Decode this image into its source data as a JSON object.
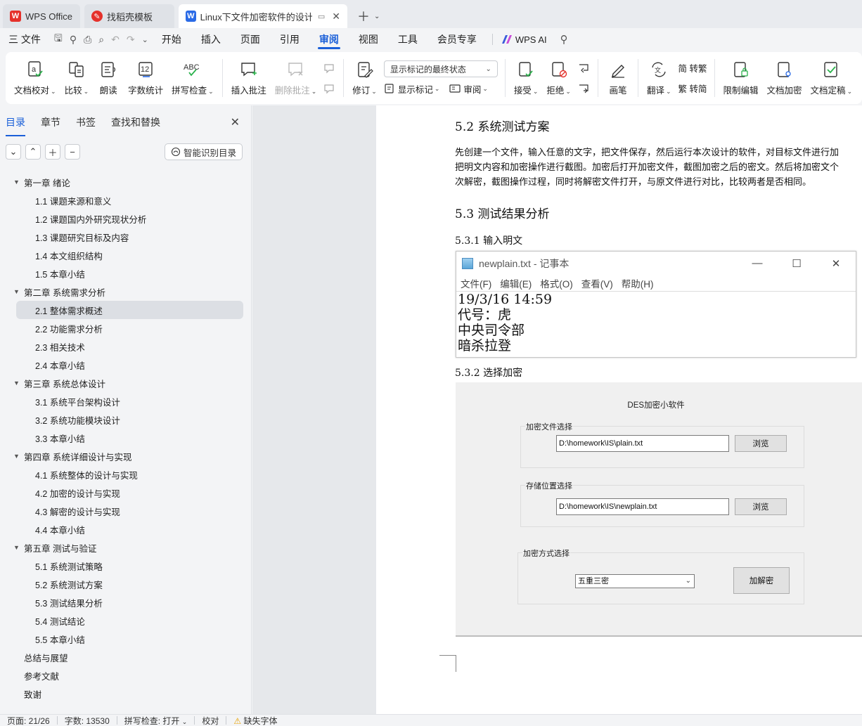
{
  "tabs": [
    {
      "label": "WPS Office"
    },
    {
      "label": "找稻壳模板"
    },
    {
      "label": "Linux下文件加密软件的设计与"
    }
  ],
  "menubar": {
    "file": "三 文件",
    "items": [
      "开始",
      "插入",
      "页面",
      "引用",
      "审阅",
      "视图",
      "工具",
      "会员专享"
    ],
    "active": "审阅",
    "wps_ai": "WPS AI"
  },
  "ribbon": {
    "doc_check": "文档校对",
    "compare": "比较",
    "read_aloud": "朗读",
    "word_count": "字数统计",
    "spell_check": "拼写检查",
    "insert_comment": "插入批注",
    "delete_comment": "删除批注",
    "revise": "修订",
    "display_mode": "显示标记的最终状态",
    "show_marks": "显示标记",
    "review": "审阅",
    "accept": "接受",
    "reject": "拒绝",
    "pen": "画笔",
    "translate": "翻译",
    "to_trad": "简 转繁",
    "to_simp": "繁 转简",
    "restrict_edit": "限制编辑",
    "doc_encrypt": "文档加密",
    "doc_finalize": "文档定稿"
  },
  "panel": {
    "tabs": [
      "目录",
      "章节",
      "书签",
      "查找和替换"
    ],
    "active_tab": "目录",
    "smart_button": "智能识别目录",
    "toc": [
      {
        "text": "第一章  绪论",
        "level": 1,
        "expanded": true
      },
      {
        "text": "1.1  课题来源和意义",
        "level": 2
      },
      {
        "text": "1.2  课题国内外研究现状分析",
        "level": 2
      },
      {
        "text": "1.3  课题研究目标及内容",
        "level": 2
      },
      {
        "text": "1.4  本文组织结构",
        "level": 2
      },
      {
        "text": "1.5 本章小结",
        "level": 2
      },
      {
        "text": "第二章  系统需求分析",
        "level": 1,
        "expanded": true
      },
      {
        "text": "2.1  整体需求概述",
        "level": 2,
        "selected": true
      },
      {
        "text": "2.2  功能需求分析",
        "level": 2
      },
      {
        "text": "2.3  相关技术",
        "level": 2
      },
      {
        "text": "2.4  本章小结",
        "level": 2
      },
      {
        "text": "第三章  系统总体设计",
        "level": 1,
        "expanded": true
      },
      {
        "text": "3.1 系统平台架构设计",
        "level": 2
      },
      {
        "text": "3.2  系统功能模块设计",
        "level": 2
      },
      {
        "text": "3.3  本章小结",
        "level": 2
      },
      {
        "text": "第四章  系统详细设计与实现",
        "level": 1,
        "expanded": true
      },
      {
        "text": "4.1 系统整体的设计与实现",
        "level": 2
      },
      {
        "text": "4.2  加密的设计与实现",
        "level": 2
      },
      {
        "text": "4.3  解密的设计与实现",
        "level": 2
      },
      {
        "text": "4.4  本章小结",
        "level": 2
      },
      {
        "text": "第五章  测试与验证",
        "level": 1,
        "expanded": true
      },
      {
        "text": "5.1  系统测试策略",
        "level": 2
      },
      {
        "text": "5.2  系统测试方案",
        "level": 2
      },
      {
        "text": "5.3  测试结果分析",
        "level": 2
      },
      {
        "text": "5.4  测试结论",
        "level": 2
      },
      {
        "text": "5.5  本章小结",
        "level": 2
      },
      {
        "text": "总结与展望",
        "level": 1
      },
      {
        "text": "参考文献",
        "level": 1
      },
      {
        "text": "致谢",
        "level": 1
      }
    ]
  },
  "document": {
    "h_52": "5.2  系统测试方案",
    "para": [
      "先创建一个文件，输入任意的文字，把文件保存，然后运行本次设计的软件，对目标文件进行加",
      "把明文内容和加密操作进行截图。加密后打开加密文件，截图加密之后的密文。然后将加密文个",
      "次解密，截图操作过程，同时将解密文件打开，与原文件进行对比，比较两者是否相同。"
    ],
    "h_53": "5.3  测试结果分析",
    "h_531": "5.3.1 输入明文",
    "h_532": "5.3.2 选择加密",
    "notepad": {
      "title": "newplain.txt - 记事本",
      "menu": [
        "文件(F)",
        "编辑(E)",
        "格式(O)",
        "查看(V)",
        "帮助(H)"
      ],
      "lines": [
        "19/3/16 14:59",
        "代号：虎",
        "中央司令部",
        "暗杀拉登"
      ]
    },
    "des": {
      "title": "DES加密小软件",
      "group1": "加密文件选择",
      "path1": "D:\\homework\\IS\\plain.txt",
      "browse": "浏览",
      "group2": "存储位置选择",
      "path2": "D:\\homework\\IS\\newplain.txt",
      "group3": "加密方式选择",
      "method": "五重三密",
      "action": "加解密"
    }
  },
  "status": {
    "page": "页面: 21/26",
    "words": "字数: 13530",
    "spell": "拼写检查: 打开",
    "proof": "校对",
    "missing_font": "缺失字体"
  },
  "colors": {
    "accent": "#1a5fd8",
    "wps_red": "#e5312b"
  }
}
